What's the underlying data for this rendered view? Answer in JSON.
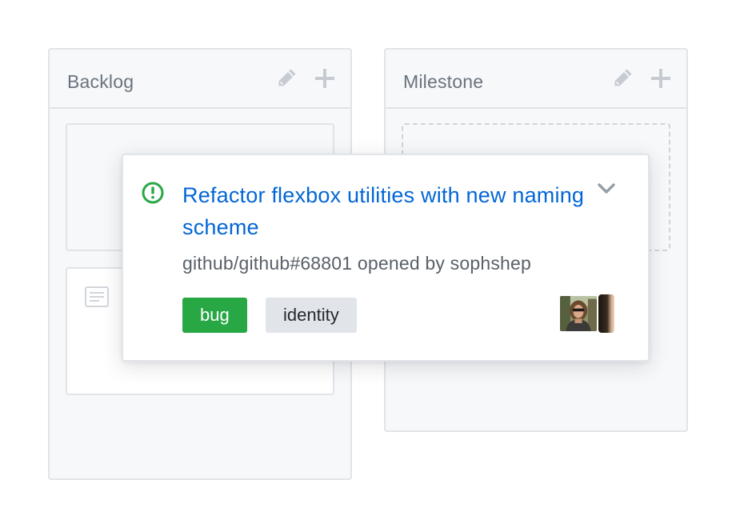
{
  "columns": [
    {
      "title": "Backlog"
    },
    {
      "title": "Milestone"
    }
  ],
  "issue_card": {
    "title": "Refactor flexbox utilities with new naming scheme",
    "meta": "github/github#68801 opened by sophshep",
    "labels": [
      {
        "name": "bug",
        "color": "#28a745"
      },
      {
        "name": "identity",
        "color": "#e1e4e8"
      }
    ],
    "status_icon": "issue-opened-icon",
    "status_color": "#28a745",
    "title_color": "#0366d6"
  },
  "icons": {
    "edit": "pencil-icon",
    "add": "plus-icon",
    "expand": "chevron-down-icon",
    "note": "note-icon"
  }
}
